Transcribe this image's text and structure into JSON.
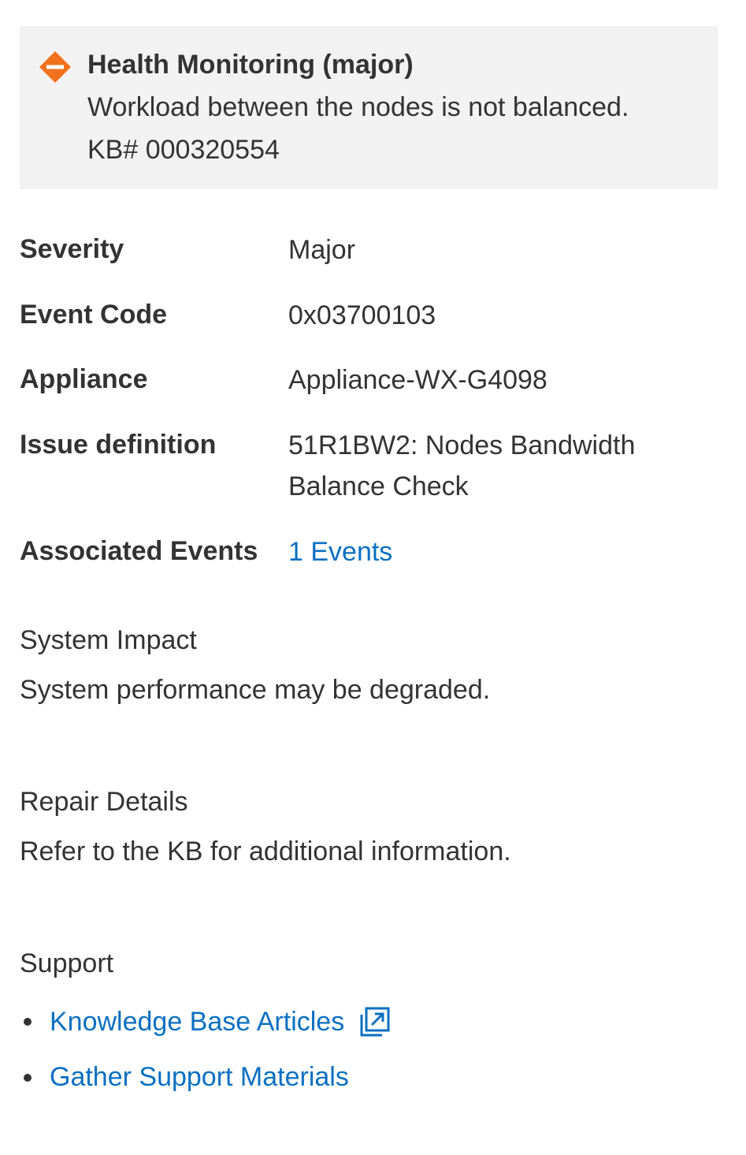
{
  "alert": {
    "icon": "major-severity-icon",
    "icon_color": "#f2711c",
    "title": "Health Monitoring (major)",
    "message": "Workload between the nodes is not balanced.",
    "kb": "KB# 000320554"
  },
  "details": {
    "severity_label": "Severity",
    "severity_value": "Major",
    "event_code_label": "Event Code",
    "event_code_value": "0x03700103",
    "appliance_label": "Appliance",
    "appliance_value": "Appliance-WX-G4098",
    "issue_definition_label": "Issue definition",
    "issue_definition_value": "51R1BW2: Nodes Bandwidth Balance Check",
    "associated_events_label": "Associated Events",
    "associated_events_value": "1 Events"
  },
  "system_impact": {
    "heading": "System Impact",
    "text": "System performance may be degraded."
  },
  "repair_details": {
    "heading": "Repair Details",
    "text": "Refer to the KB for additional information."
  },
  "support": {
    "heading": "Support",
    "links": [
      {
        "label": "Knowledge Base Articles",
        "icon": "external-link-icon"
      },
      {
        "label": "Gather Support Materials"
      }
    ]
  },
  "colors": {
    "link": "#0a70c2",
    "text": "#333333",
    "alert_background": "#f2f2f2"
  }
}
